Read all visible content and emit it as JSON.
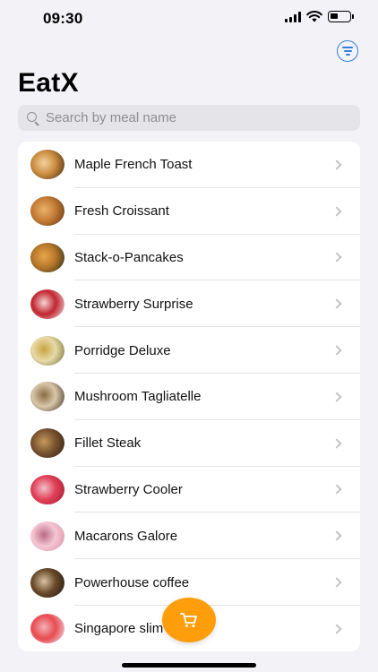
{
  "status_bar": {
    "time": "09:30"
  },
  "app": {
    "title": "EatX"
  },
  "search": {
    "placeholder": "Search by meal name",
    "value": ""
  },
  "meals": [
    {
      "name": "Maple French Toast",
      "colors": [
        "#3a2410",
        "#c98b3e",
        "#f2d3a0"
      ]
    },
    {
      "name": "Fresh Croissant",
      "colors": [
        "#5a3413",
        "#c47a35",
        "#e9b36a"
      ]
    },
    {
      "name": "Stack-o-Pancakes",
      "colors": [
        "#1f2a1a",
        "#b6762a",
        "#e8a64a"
      ]
    },
    {
      "name": "Strawberry Surprise",
      "colors": [
        "#f5eaea",
        "#c02630",
        "#f7d3d3"
      ]
    },
    {
      "name": "Porridge Deluxe",
      "colors": [
        "#6c6a2e",
        "#e8d9a8",
        "#c9a440"
      ]
    },
    {
      "name": "Mushroom Tagliatelle",
      "colors": [
        "#3a2a1c",
        "#d8c7a8",
        "#8a6a44"
      ]
    },
    {
      "name": "Fillet Steak",
      "colors": [
        "#2a1b10",
        "#7a5230",
        "#c49a5a"
      ]
    },
    {
      "name": "Strawberry Cooler",
      "colors": [
        "#9c1a2c",
        "#e04058",
        "#f2c2c8"
      ]
    },
    {
      "name": "Macarons Galore",
      "colors": [
        "#d88ca4",
        "#f5c6d4",
        "#b86a86"
      ]
    },
    {
      "name": "Powerhouse coffee",
      "colors": [
        "#1a1410",
        "#6a4a2a",
        "#d8c4a0"
      ]
    },
    {
      "name": "Singapore slim",
      "colors": [
        "#f0eef2",
        "#e84a50",
        "#f3b2b6"
      ]
    }
  ],
  "icons": {
    "filter": "filter-icon",
    "cart": "cart-icon",
    "chevron": "chevron-right-icon",
    "search": "search-icon"
  },
  "theme": {
    "accent": "#2f7fe0",
    "fab": "#ff9d0a",
    "background": "#f2f2f7"
  }
}
